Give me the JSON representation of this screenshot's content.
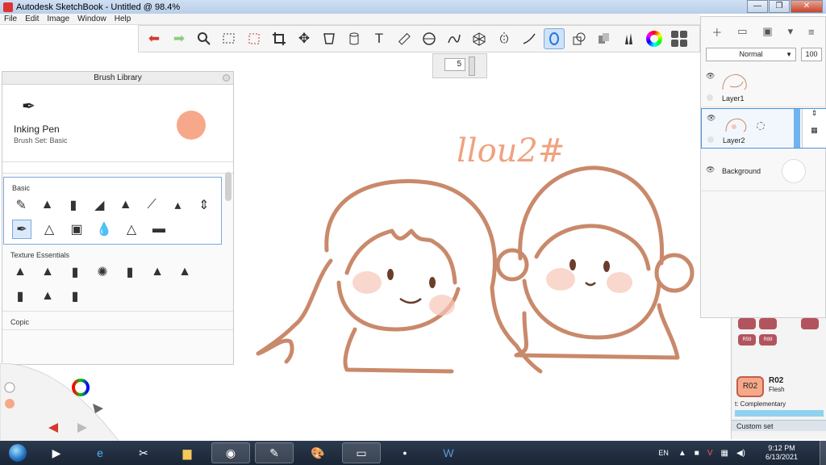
{
  "window": {
    "title": "Autodesk SketchBook - Untitled @ 98.4%",
    "minimize": "—",
    "maximize": "❐",
    "close": "✕"
  },
  "menu": [
    "File",
    "Edit",
    "Image",
    "Window",
    "Help"
  ],
  "toolbar": {
    "undo_icon": "undo-arrow",
    "redo_icon": "redo-arrow",
    "tools": [
      "zoom",
      "select-rect",
      "select-lasso",
      "crop",
      "transform",
      "perspective",
      "bucket",
      "text",
      "ruler",
      "ellipse",
      "french-curve",
      "perspective-grid",
      "symmetry",
      "stroke",
      "ellipse-tool",
      "shapes",
      "copic",
      "brushes",
      "color-wheel",
      "swatches"
    ]
  },
  "brush_size": {
    "value": "5"
  },
  "brush_library": {
    "header": "Brush Library",
    "current": {
      "name": "Inking Pen",
      "set": "Brush Set: Basic",
      "color": "#f8a88a"
    },
    "sections": [
      {
        "title": "Basic"
      },
      {
        "title": "Texture Essentials"
      },
      {
        "title": "Copic"
      }
    ]
  },
  "layers": {
    "blend_mode": "Normal",
    "opacity": "100",
    "items": [
      {
        "name": "Layer1"
      },
      {
        "name": "Layer2"
      },
      {
        "name": "Background"
      }
    ]
  },
  "copic": {
    "chips": [
      "R59",
      "R89"
    ],
    "selected_code": "R02",
    "selected_name": "Flesh",
    "complementary": "t: Complementary",
    "custom_set": "Custom set",
    "selected_color": "#f8a88a"
  },
  "taskbar": {
    "language": "EN",
    "time": "9:12 PM",
    "date": "6/13/2021"
  },
  "canvas": {
    "signature": "llou2#",
    "stroke_color": "#c9896b"
  }
}
